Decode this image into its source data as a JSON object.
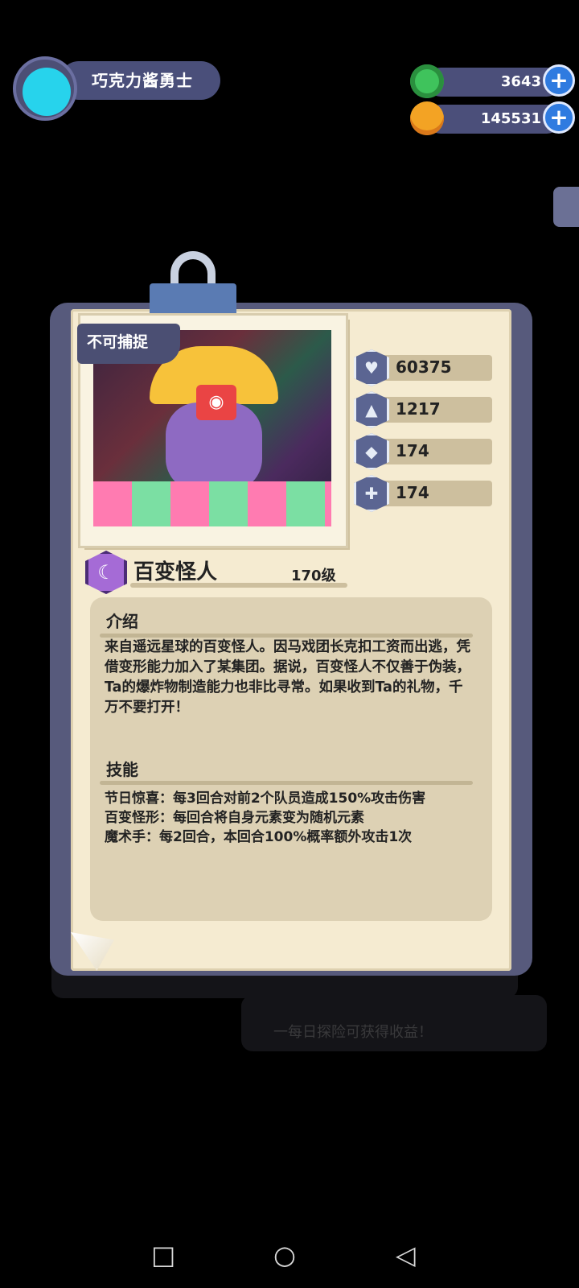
{
  "profile": {
    "name": "巧克力酱勇士"
  },
  "currencies": [
    {
      "name": "green-gem",
      "value": "3643",
      "color": "#3fc35c"
    },
    {
      "name": "gold-coin",
      "value": "145531",
      "color": "#f3a324"
    }
  ],
  "card": {
    "tag": "不可捕捉",
    "stats": [
      {
        "icon": "heart-icon",
        "value": "60375"
      },
      {
        "icon": "sword-icon",
        "value": "1217"
      },
      {
        "icon": "shield-icon",
        "value": "174"
      },
      {
        "icon": "speed-icon",
        "value": "174"
      }
    ],
    "name": "百变怪人",
    "level": "170级",
    "intro_title": "介绍",
    "intro_text": "来自遥远星球的百变怪人。因马戏团长克扣工资而出逃，凭借变形能力加入了某集团。据说，百变怪人不仅善于伪装，Ta的爆炸物制造能力也非比寻常。如果收到Ta的礼物，千万不要打开！",
    "skills_title": "技能",
    "skills": [
      "节日惊喜：每3回合对前2个队员造成150%攻击伤害",
      "百变怪形：每回合将自身元素变为随机元素",
      "魔术手：每2回合，本回合100%概率额外攻击1次"
    ]
  },
  "background_hint": "一每日探险可获得收益！",
  "navbar": {
    "square": "□",
    "circle": "○",
    "back": "◁"
  }
}
